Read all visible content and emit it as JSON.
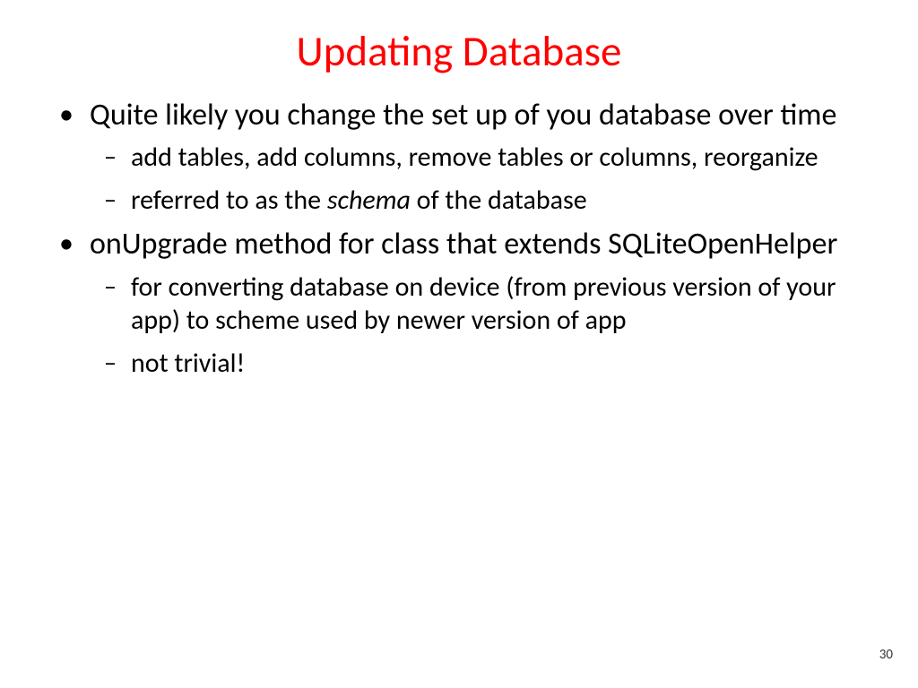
{
  "slide": {
    "title": "Updating Database",
    "page_number": "30",
    "bullets": [
      {
        "text": "Quite likely you change the set up of you database over time",
        "sub": [
          {
            "text": "add tables, add columns, remove tables or columns, reorganize"
          },
          {
            "pre": "referred to as the ",
            "italic": "schema",
            "post": " of the database"
          }
        ]
      },
      {
        "text": "onUpgrade method for class that extends SQLiteOpenHelper",
        "sub": [
          {
            "text": " for converting database on device (from previous version of your app) to scheme used by newer version of app"
          },
          {
            "text": "not trivial!"
          }
        ]
      }
    ]
  }
}
